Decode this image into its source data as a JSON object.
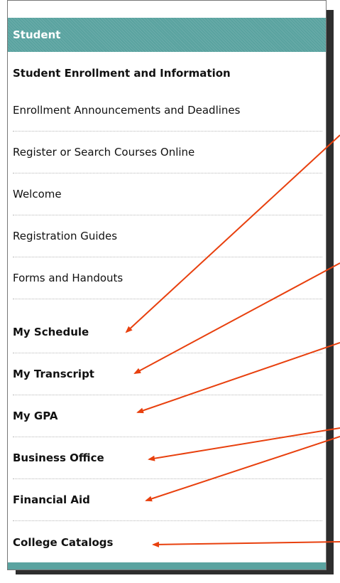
{
  "panel": {
    "header": "Student",
    "section_title": "Student Enrollment and Information",
    "items": [
      {
        "label": "Enrollment Announcements and Deadlines",
        "bold": false
      },
      {
        "label": "Register or Search Courses Online",
        "bold": false
      },
      {
        "label": "Welcome",
        "bold": false
      },
      {
        "label": "Registration Guides",
        "bold": false
      },
      {
        "label": "Forms and Handouts",
        "bold": false
      },
      {
        "label": "My Schedule",
        "bold": true
      },
      {
        "label": "My Transcript",
        "bold": true
      },
      {
        "label": "My GPA",
        "bold": true
      },
      {
        "label": "Business Office",
        "bold": true
      },
      {
        "label": "Financial Aid",
        "bold": true
      },
      {
        "label": "College Catalogs",
        "bold": true
      }
    ]
  },
  "colors": {
    "header_bg": "#5aa3a0",
    "arrow": "#e8400e",
    "shadow": "#2e2e2e"
  }
}
